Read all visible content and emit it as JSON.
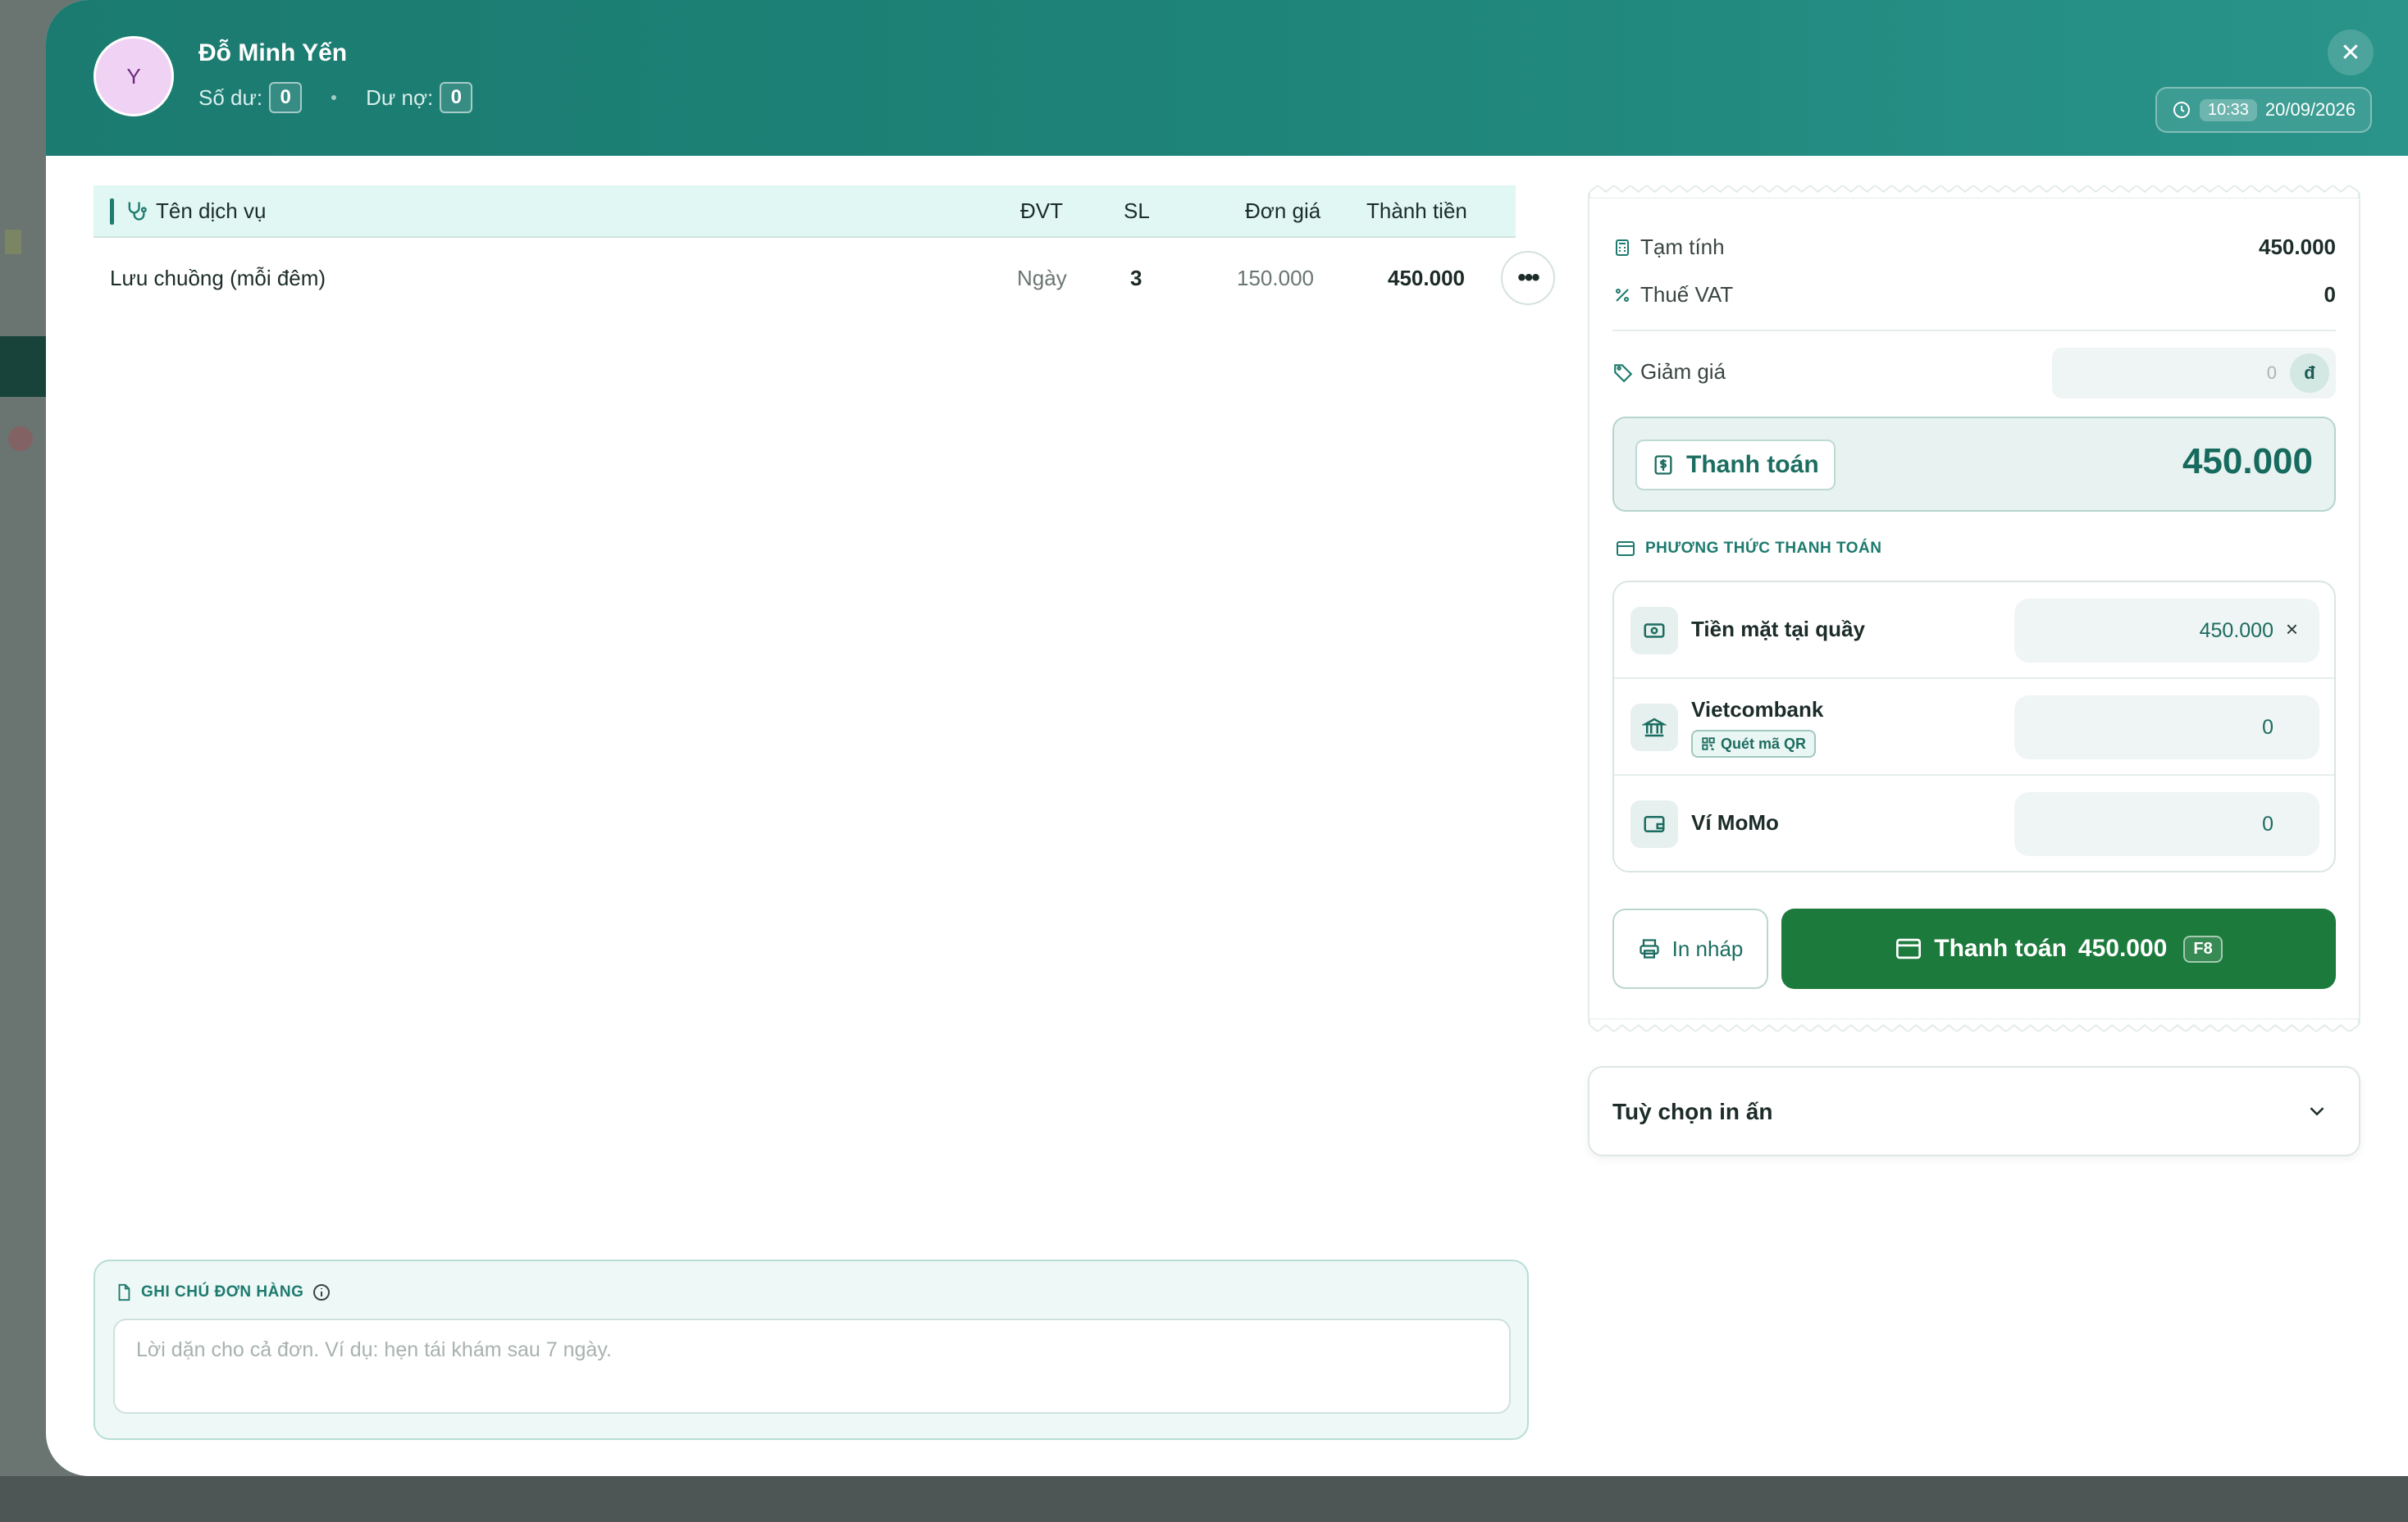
{
  "customer": {
    "avatar_letter": "Y",
    "name": "Đỗ Minh Yến",
    "balance_label": "Số dư:",
    "balance_value": "0",
    "debt_label": "Dư nợ:",
    "debt_value": "0"
  },
  "header": {
    "close_symbol": "✕",
    "time": "10:33",
    "date": "20/09/2026"
  },
  "table": {
    "columns": [
      "Tên dịch vụ",
      "ĐVT",
      "SL",
      "Đơn giá",
      "Thành tiền"
    ],
    "rows": [
      {
        "name": "Lưu chuồng (mỗi đêm)",
        "unit": "Ngày",
        "qty": "3",
        "price": "150.000",
        "total": "450.000",
        "more": "•••"
      }
    ]
  },
  "note": {
    "title": "GHI CHÚ ĐƠN HÀNG",
    "placeholder": "Lời dặn cho cả đơn. Ví dụ: hẹn tái khám sau 7 ngày."
  },
  "summary": {
    "subtotal_label": "Tạm tính",
    "subtotal_value": "450.000",
    "vat_label": "Thuế VAT",
    "vat_value": "0",
    "discount_label": "Giảm giá",
    "discount_value": "0",
    "discount_unit": "đ",
    "pay_label": "Thanh toán",
    "pay_amount": "450.000"
  },
  "payment_methods": {
    "title": "PHƯƠNG THỨC THANH TOÁN",
    "items": [
      {
        "label": "Tiền mặt tại quầy",
        "value": "450.000",
        "clear": "×",
        "icon": "cash-icon"
      },
      {
        "label": "Vietcombank",
        "value": "0",
        "badge": "Quét mã QR",
        "icon": "bank-icon"
      },
      {
        "label": "Ví MoMo",
        "value": "0",
        "icon": "wallet-icon"
      }
    ]
  },
  "actions": {
    "draft_label": "In nháp",
    "pay_label": "Thanh toán",
    "pay_amount": "450.000",
    "pay_shortcut": "F8"
  },
  "print_options": {
    "label": "Tuỳ chọn in ấn"
  },
  "colors": {
    "header": "#1e8379",
    "accent": "#1d7a6e",
    "pay_button": "#1c7a3c",
    "table_header": "#e1f7f3"
  }
}
